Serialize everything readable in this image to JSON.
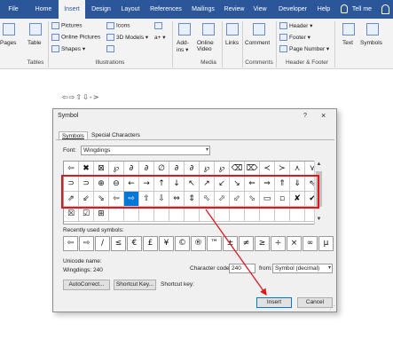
{
  "ribbon_tabs": [
    "File",
    "Home",
    "Insert",
    "Design",
    "Layout",
    "References",
    "Mailings",
    "Review",
    "View",
    "Developer",
    "Help",
    "Tell me"
  ],
  "active_tab": "Insert",
  "ribbon": {
    "pages": "Pages",
    "table": "Table",
    "tables_group": "Tables",
    "pictures": "Pictures",
    "online_pictures": "Online Pictures",
    "shapes": "Shapes",
    "icons": "Icons",
    "models": "3D Models",
    "illustrations_group": "Illustrations",
    "addins": "Add-\nins",
    "online_video": "Online Video",
    "media_group": "Media",
    "links": "Links",
    "comment": "Comment",
    "comments_group": "Comments",
    "header": "Header",
    "footer": "Footer",
    "page_number": "Page Number",
    "header_footer_group": "Header & Footer",
    "text": "Text",
    "symbols": "Symbols"
  },
  "document": {
    "symbol_line": "⇦⇨⇧⇩->"
  },
  "dialog": {
    "title": "Symbol",
    "help": "?",
    "close": "×",
    "tabs": [
      "Symbols",
      "Special Characters"
    ],
    "font_label": "Font:",
    "font_value": "Wingdings",
    "rows": [
      [
        "⇦",
        "✖",
        "⊠",
        "℘",
        "∂",
        "∂",
        "∅",
        "∂",
        "∂",
        "℘",
        "℘",
        "⌫",
        "⌦",
        "≺",
        "≻",
        "⋏",
        "⋎"
      ],
      [
        "⊃",
        "⊃",
        "⊕",
        "⊖",
        "←",
        "→",
        "↑",
        "↓",
        "↖",
        "↗",
        "↙",
        "↘",
        "⇐",
        "⇒",
        "⇑",
        "⇓",
        "⇖"
      ],
      [
        "⇗",
        "⇙",
        "⇘",
        "⇦",
        "⇨",
        "⇧",
        "⇩",
        "⇔",
        "⇕",
        "⬁",
        "⬀",
        "⬃",
        "⬂",
        "▭",
        "▫",
        "✘",
        "✔"
      ],
      [
        "☒",
        "☑",
        "⊞",
        "",
        "",
        "",
        "",
        "",
        "",
        "",
        "",
        "",
        "",
        "",
        "",
        "",
        ""
      ]
    ],
    "selected": "⇨",
    "recent_label": "Recently used symbols:",
    "recent": [
      "⇦",
      "⇨",
      "/",
      "≤",
      "€",
      "£",
      "¥",
      "©",
      "®",
      "™",
      "±",
      "≠",
      "≥",
      "÷",
      "×",
      "∞",
      "µ"
    ],
    "unicode_name_label": "Unicode name:",
    "unicode_name_value": "Wingdings: 240",
    "char_code_label": "Character code:",
    "char_code_value": "240",
    "from_label": "from:",
    "from_value": "Symbol (decimal)",
    "autocorrect": "AutoCorrect...",
    "shortcut_key_btn": "Shortcut Key...",
    "shortcut_key_label": "Shortcut key:",
    "insert": "Insert",
    "cancel": "Cancel"
  }
}
